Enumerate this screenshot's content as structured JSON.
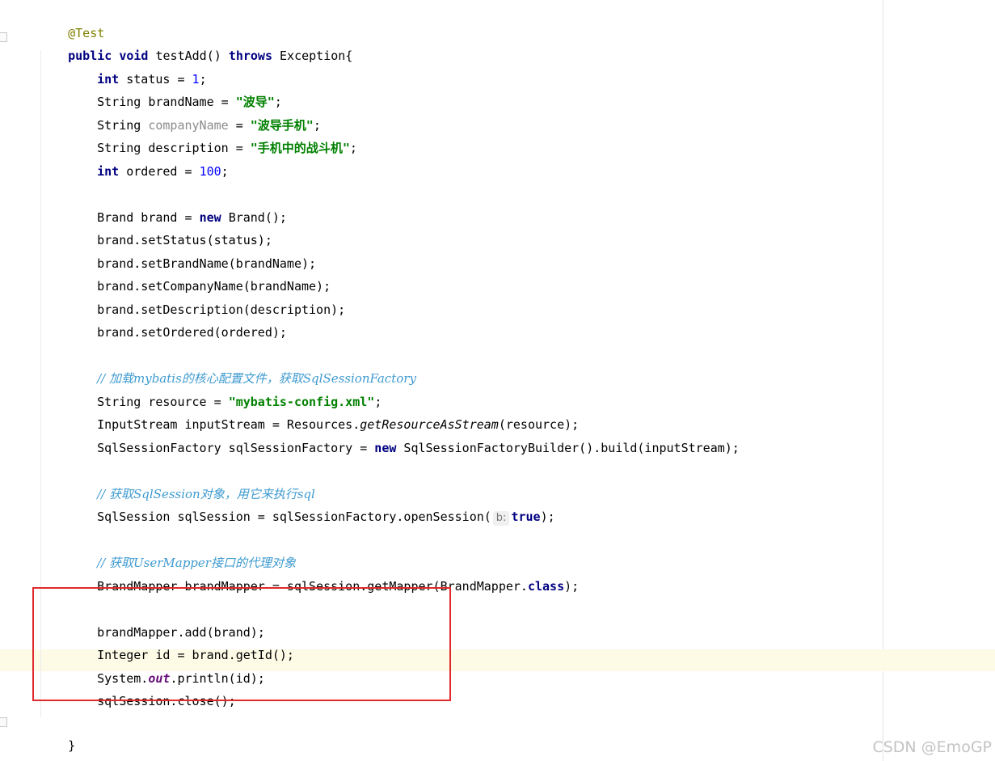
{
  "watermark": "CSDN @EmoGP",
  "code": {
    "annotation": "@Test",
    "method_sig": {
      "kw_public": "public",
      "kw_void": "void",
      "name": "testAdd()",
      "kw_throws": "throws",
      "rest": "Exception{"
    },
    "l_status": {
      "kw": "int",
      "mid": "status = ",
      "num": "1",
      "end": ";"
    },
    "l_brandName": {
      "pre": "String brandName = ",
      "str": "\"波导\"",
      "end": ";"
    },
    "l_companyName": {
      "pre": "String ",
      "unused": "companyName",
      "mid": " = ",
      "str": "\"波导手机\"",
      "end": ";"
    },
    "l_description": {
      "pre": "String description = ",
      "str": "\"手机中的战斗机\"",
      "end": ";"
    },
    "l_ordered": {
      "kw": "int",
      "mid": "ordered = ",
      "num": "100",
      "end": ";"
    },
    "l_newBrand": {
      "pre": "Brand brand = ",
      "kw": "new",
      "post": "Brand();"
    },
    "l_setStatus": "brand.setStatus(status);",
    "l_setBrandName": "brand.setBrandName(brandName);",
    "l_setCompanyName": "brand.setCompanyName(brandName);",
    "l_setDescription": "brand.setDescription(description);",
    "l_setOrdered": "brand.setOrdered(ordered);",
    "c_loadConfig": "// 加载mybatis的核心配置文件，获取SqlSessionFactory",
    "l_resource": {
      "pre": "String resource = ",
      "str": "\"mybatis-config.xml\"",
      "end": ";"
    },
    "l_inputStream": {
      "pre": "InputStream inputStream = Resources.",
      "static": "getResourceAsStream",
      "post": "(resource);"
    },
    "l_factory": {
      "pre": "SqlSessionFactory sqlSessionFactory = ",
      "kw": "new",
      "post": "SqlSessionFactoryBuilder().build(inputStream);"
    },
    "c_getSession": "// 获取SqlSession对象，用它来执行sql",
    "l_openSession": {
      "pre": "SqlSession sqlSession = sqlSessionFactory.openSession(",
      "hint": "b:",
      "kw": "true",
      "end": ");"
    },
    "c_getMapper": "// 获取UserMapper接口的代理对象",
    "l_getMapper": {
      "pre": "BrandMapper brandMapper = sqlSession.getMapper(BrandMapper.",
      "kw": "class",
      "end": ");"
    },
    "l_add": "brandMapper.add(brand);",
    "l_getId": "Integer id = brand.getId();",
    "l_println": {
      "pre": "System.",
      "field": "out",
      "post": ".println(id);"
    },
    "l_close": "sqlSession.close();",
    "close_method": "}",
    "close_class": "}"
  }
}
